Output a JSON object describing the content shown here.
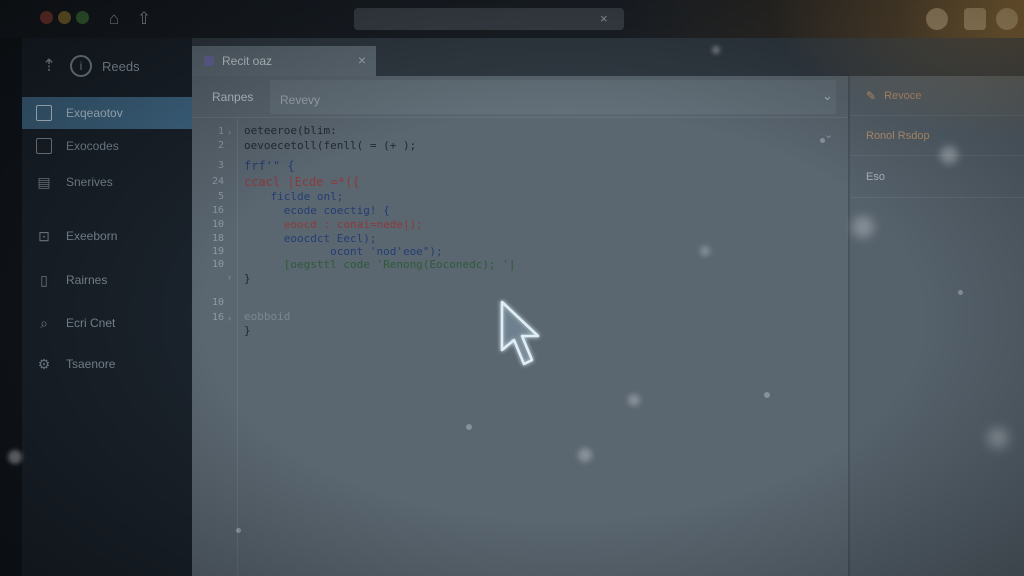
{
  "window": {
    "colors": {
      "red": "#7a3a32",
      "yellow": "#7e6a30",
      "green": "#3d6a3a"
    },
    "toolbar_icons": [
      "home-icon",
      "up-arrow-icon"
    ],
    "address_bar": {
      "close_glyph": "×"
    },
    "right_icons": [
      "avatar-icon",
      "extension-icon",
      "profile-icon"
    ]
  },
  "sidebar": {
    "header": {
      "label": "Reeds"
    },
    "items": [
      {
        "label": "Exqeaotov",
        "icon": "square-icon",
        "active": true
      },
      {
        "label": "Exocodes",
        "icon": "square-icon",
        "active": false
      },
      {
        "label": "Snerives",
        "icon": "document-icon",
        "active": false
      },
      {
        "label": "Exeeborn",
        "icon": "lock-icon",
        "active": false
      },
      {
        "label": "Rairnes",
        "icon": "file-icon",
        "active": false
      },
      {
        "label": "Ecri Cnet",
        "icon": "search-icon",
        "active": false
      },
      {
        "label": "Tsaenore",
        "icon": "settings-icon",
        "active": false
      }
    ]
  },
  "editor": {
    "tab": {
      "label": "Recit oaz",
      "close": "×"
    },
    "subbar": {
      "label": "Ranpes",
      "field_value": "Revevy",
      "chevron": "⌄"
    },
    "line_numbers": [
      "1",
      "2",
      "3",
      "24",
      "5",
      "16",
      "10",
      "18",
      "19",
      "10",
      "10",
      "16"
    ],
    "code_lines": [
      {
        "text": "oeteeroe(blim:",
        "tone": "dark"
      },
      {
        "text": "oevoecetoll(fenll( = (+ );",
        "tone": "dark"
      },
      {
        "text": "frf'\" {",
        "tone": "blue"
      },
      {
        "text": "ccacl |Ecde =*({",
        "tone": "mixed"
      },
      {
        "text": "    ficlde onl;",
        "tone": "blue"
      },
      {
        "text": "      ecode coectig! {",
        "tone": "blue"
      },
      {
        "text": "      eoocd : conai=nede|);",
        "tone": "mixed"
      },
      {
        "text": "      eoocdct Eecl);",
        "tone": "blue"
      },
      {
        "text": "             ocont 'nod'eoe\");",
        "tone": "mixed"
      },
      {
        "text": "      [oegsttl code 'Renong(Eoconedc); '|",
        "tone": "green"
      },
      {
        "text": "}",
        "tone": "dark"
      },
      {
        "text": "eobboid",
        "tone": "gray"
      },
      {
        "text": "}",
        "tone": "dark"
      }
    ]
  },
  "right_panel": {
    "items": [
      {
        "label": "Revoce",
        "icon": "edit-icon"
      },
      {
        "label": "Ronol Rsdop",
        "icon": ""
      },
      {
        "label": "Eso",
        "icon": ""
      }
    ]
  }
}
